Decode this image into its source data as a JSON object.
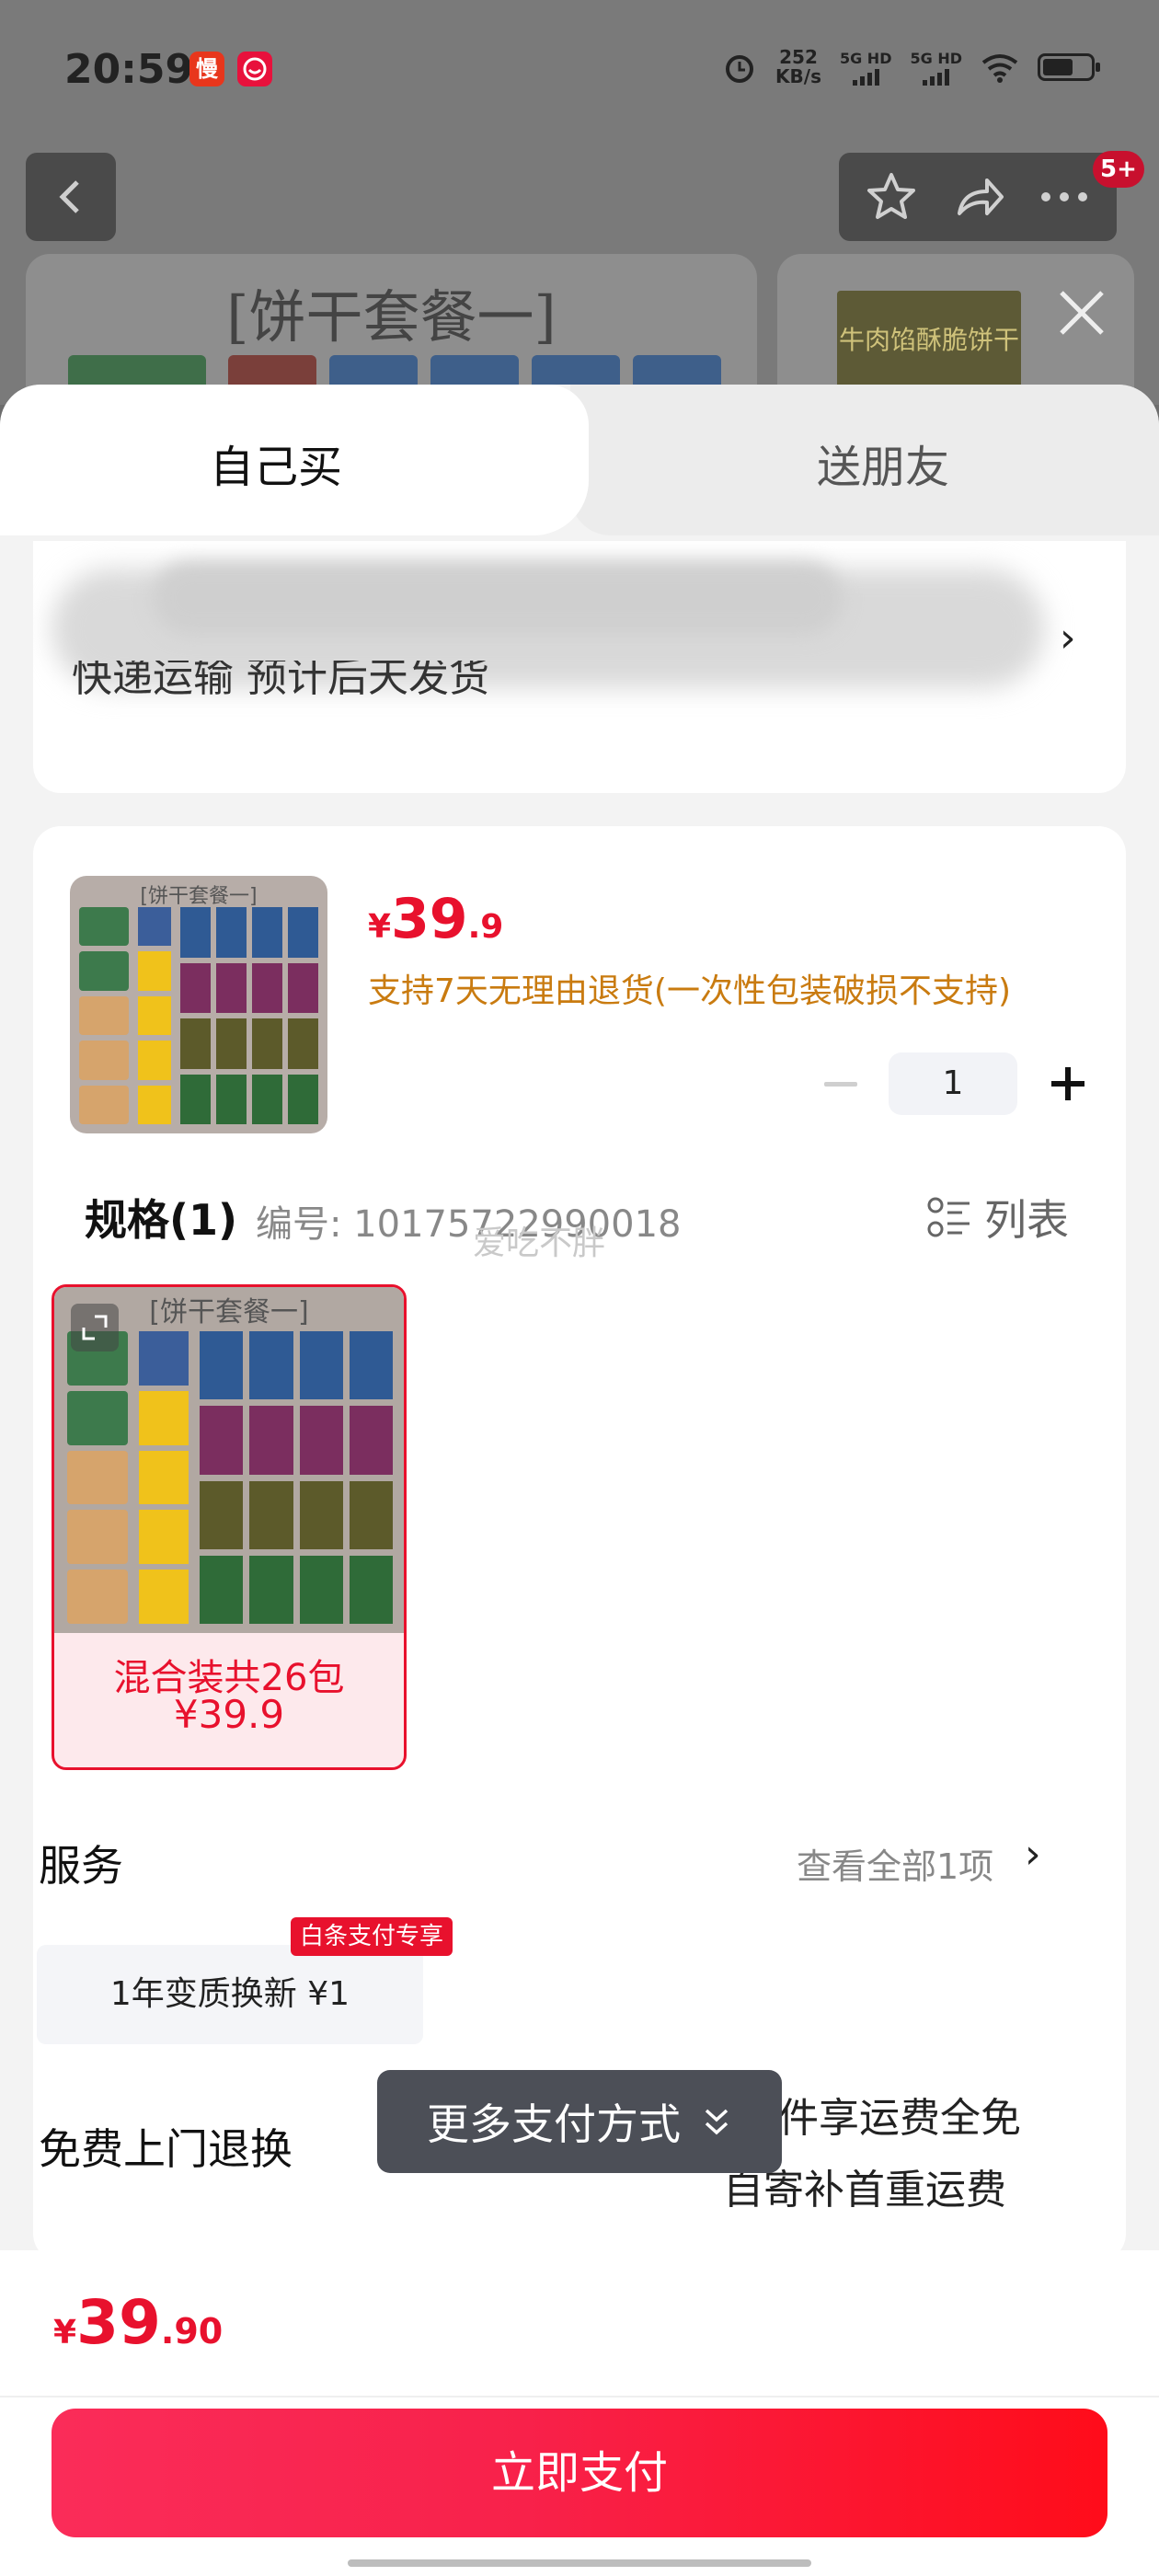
{
  "status_bar": {
    "time": "20:59",
    "app_badge_1": "慢",
    "net_speed": "252",
    "net_speed_unit": "KB/s",
    "signal_1": "5G HD",
    "signal_2": "5G HD"
  },
  "header": {
    "notification_count": "5+",
    "bg_card_title": "[饼干套餐一]",
    "bg_card2_text": "牛肉馅酥脆饼干"
  },
  "tabs": {
    "self": "自己买",
    "gift": "送朋友"
  },
  "address": {
    "shipping": "快递运输 预计后天发货"
  },
  "product": {
    "thumb_title": "[饼干套餐一]",
    "currency": "¥",
    "price_int": "39",
    "price_dec": ".9",
    "returns_note": "支持7天无理由退货(一次性包装破损不支持)",
    "quantity": "1"
  },
  "spec": {
    "title": "规格(1)",
    "code": "编号: 10175722990018",
    "watermark": "爱吃不胖",
    "list_label": "列表",
    "option_title": "[饼干套餐一]",
    "option_label": "混合装共26包",
    "option_price": "¥39.9"
  },
  "service": {
    "title": "服务",
    "view_all": "查看全部1项",
    "chip_label": "1年变质换新  ¥1",
    "chip_badge": "白条支付专享"
  },
  "free_return": {
    "title": "免费上门退换",
    "note_1": "件享运费全免",
    "note_2": "自寄补首重运费"
  },
  "more_payment": {
    "label": "更多支付方式"
  },
  "footer": {
    "currency": "¥",
    "total_int": "39",
    "total_dec": ".90",
    "pay_label": "立即支付"
  },
  "colors": {
    "accent_red": "#e8112d",
    "return_orange": "#c97b10"
  }
}
